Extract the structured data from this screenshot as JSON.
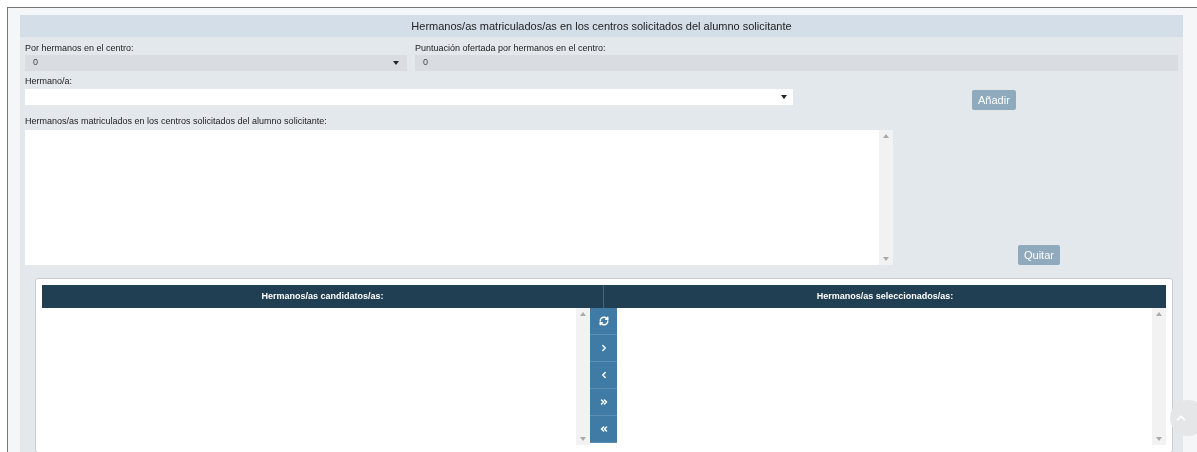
{
  "section": {
    "title": "Hermanos/as matriculados/as en los centros solicitados del alumno solicitante"
  },
  "fields": {
    "por_hermanos": {
      "label": "Por hermanos en el centro:",
      "value": "0"
    },
    "puntuacion": {
      "label": "Puntuación ofertada por hermanos en el centro:",
      "value": "0"
    },
    "hermano": {
      "label": "Hermano/a:"
    },
    "matriculados": {
      "label": "Hermanos/as matriculados en los centros solicitados del alumno solicitante:"
    }
  },
  "buttons": {
    "add": {
      "label": "Añadir",
      "disabled": true
    },
    "remove": {
      "label": "Quitar",
      "disabled": true
    }
  },
  "dual_list": {
    "left_title": "Hermanos/as candidatos/as:",
    "right_title": "Hermanos/as seleccionados/as:",
    "actions": [
      {
        "kind": "refresh"
      },
      {
        "kind": "move-right"
      },
      {
        "kind": "move-left"
      },
      {
        "kind": "move-all-right"
      },
      {
        "kind": "move-all-left"
      }
    ]
  }
}
